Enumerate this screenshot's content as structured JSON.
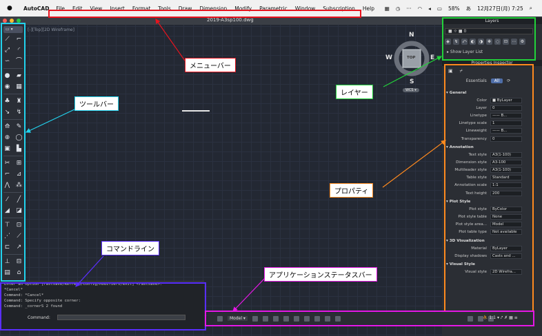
{
  "menubar": {
    "app_name": "AutoCAD",
    "items": [
      "File",
      "Edit",
      "View",
      "Insert",
      "Format",
      "Tools",
      "Draw",
      "Dimension",
      "Modify",
      "Parametric",
      "Window",
      "Subscription",
      "Help"
    ],
    "battery": "58%",
    "datetime": "12月27日(月)  7:25"
  },
  "document": {
    "title": "2019-A3sp100.dwg",
    "view_label": "[-][Top][2D Wireframe]"
  },
  "toolbar": {
    "select_label": "▭ ▾"
  },
  "viewcube": {
    "north": "N",
    "south": "S",
    "east": "E",
    "west": "W",
    "top": "TOP",
    "wcs": "WCS ▾"
  },
  "layers": {
    "title": "Layers",
    "current": "■ ☼ ■ 0",
    "show_list": "Show Layer List"
  },
  "properties": {
    "title": "Properties Inspector",
    "tabs": [
      "Essentials",
      "All"
    ],
    "sections": [
      {
        "name": "General",
        "rows": [
          {
            "label": "Color",
            "value": "■ ByLayer"
          },
          {
            "label": "Layer",
            "value": "0"
          },
          {
            "label": "Linetype",
            "value": "—— B..."
          },
          {
            "label": "Linetype scale",
            "value": "1"
          },
          {
            "label": "Lineweight",
            "value": "—— B..."
          },
          {
            "label": "Transparency",
            "value": "0"
          }
        ]
      },
      {
        "name": "Annotation",
        "rows": [
          {
            "label": "Text style",
            "value": "A3(1-100)"
          },
          {
            "label": "Dimension style",
            "value": "A3-100"
          },
          {
            "label": "Multileader style",
            "value": "A3(1-100)"
          },
          {
            "label": "Table style",
            "value": "Standard"
          },
          {
            "label": "Annotation scale",
            "value": "1:1"
          },
          {
            "label": "Text height",
            "value": "200"
          }
        ]
      },
      {
        "name": "Plot Style",
        "rows": [
          {
            "label": "Plot style",
            "value": "ByColor"
          },
          {
            "label": "Plot style table",
            "value": "None"
          },
          {
            "label": "Plot style area...",
            "value": "Model"
          },
          {
            "label": "Plot table type",
            "value": "Not available"
          }
        ]
      },
      {
        "name": "3D Visualization",
        "rows": [
          {
            "label": "Material",
            "value": "ByLayer"
          },
          {
            "label": "Display shadows",
            "value": "Casts and ..."
          }
        ]
      },
      {
        "name": "Visual Style",
        "rows": [
          {
            "label": "Visual style",
            "value": "2D Wirefra..."
          }
        ]
      }
    ]
  },
  "command": {
    "history": [
      "Enter an option [Fastsave/Refresh/Config/Modifiers/eXit] <Fastsave>:",
      "*Cancel*",
      "Command: *Cancel*",
      "Command: Specify opposite corner:",
      "Command: _cornerS 2 found"
    ],
    "prompt": "Command:"
  },
  "statusbar": {
    "model": "Model ▾",
    "scale": "1:1 ▾"
  },
  "annotations": {
    "menubar": "メニューバー",
    "toolbar": "ツールバー",
    "layers": "レイヤー",
    "properties": "プロパティ",
    "commandline": "コマンドライン",
    "statusbar": "アプリケーションステータスバー",
    "colors": {
      "menubar": "#e8141e",
      "toolbar": "#22d3ee",
      "layers": "#22d33a",
      "properties": "#ff8a1e",
      "commandline": "#5a2eff",
      "statusbar": "#e617e6"
    }
  }
}
